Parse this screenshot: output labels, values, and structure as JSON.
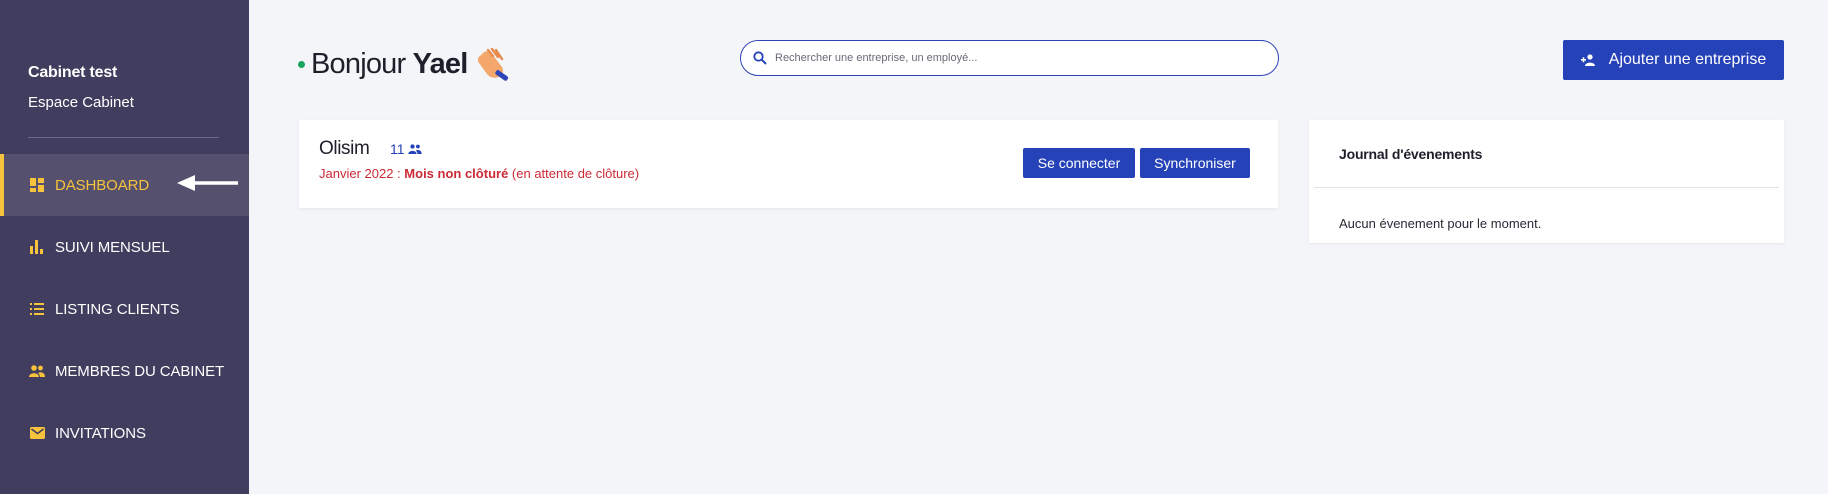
{
  "sidebar": {
    "brand_name": "Cabinet test",
    "brand_sub": "Espace Cabinet",
    "items": [
      {
        "label": "DASHBOARD",
        "icon": "dashboard-icon",
        "active": true
      },
      {
        "label": "SUIVI MENSUEL",
        "icon": "bar-chart-icon",
        "active": false
      },
      {
        "label": "LISTING CLIENTS",
        "icon": "list-icon",
        "active": false
      },
      {
        "label": "MEMBRES DU CABINET",
        "icon": "people-icon",
        "active": false
      },
      {
        "label": "INVITATIONS",
        "icon": "mail-icon",
        "active": false
      }
    ]
  },
  "header": {
    "greeting_prefix": "Bonjour",
    "user_name": "Yael",
    "search_placeholder": "Rechercher une entreprise, un employé...",
    "add_company_label": "Ajouter une entreprise"
  },
  "company": {
    "name": "Olisim",
    "employee_count": "11",
    "period": "Janvier 2022 :",
    "status": "Mois non clôturé",
    "status_note": "(en attente de clôture)",
    "connect_label": "Se connecter",
    "sync_label": "Synchroniser"
  },
  "journal": {
    "title": "Journal d'évenements",
    "empty_text": "Aucun évenement pour le moment."
  },
  "colors": {
    "sidebar_bg": "#403d5e",
    "active_accent": "#f7c23c",
    "primary": "#2542b8",
    "alert": "#cc2a36",
    "online": "#1aa35c"
  }
}
